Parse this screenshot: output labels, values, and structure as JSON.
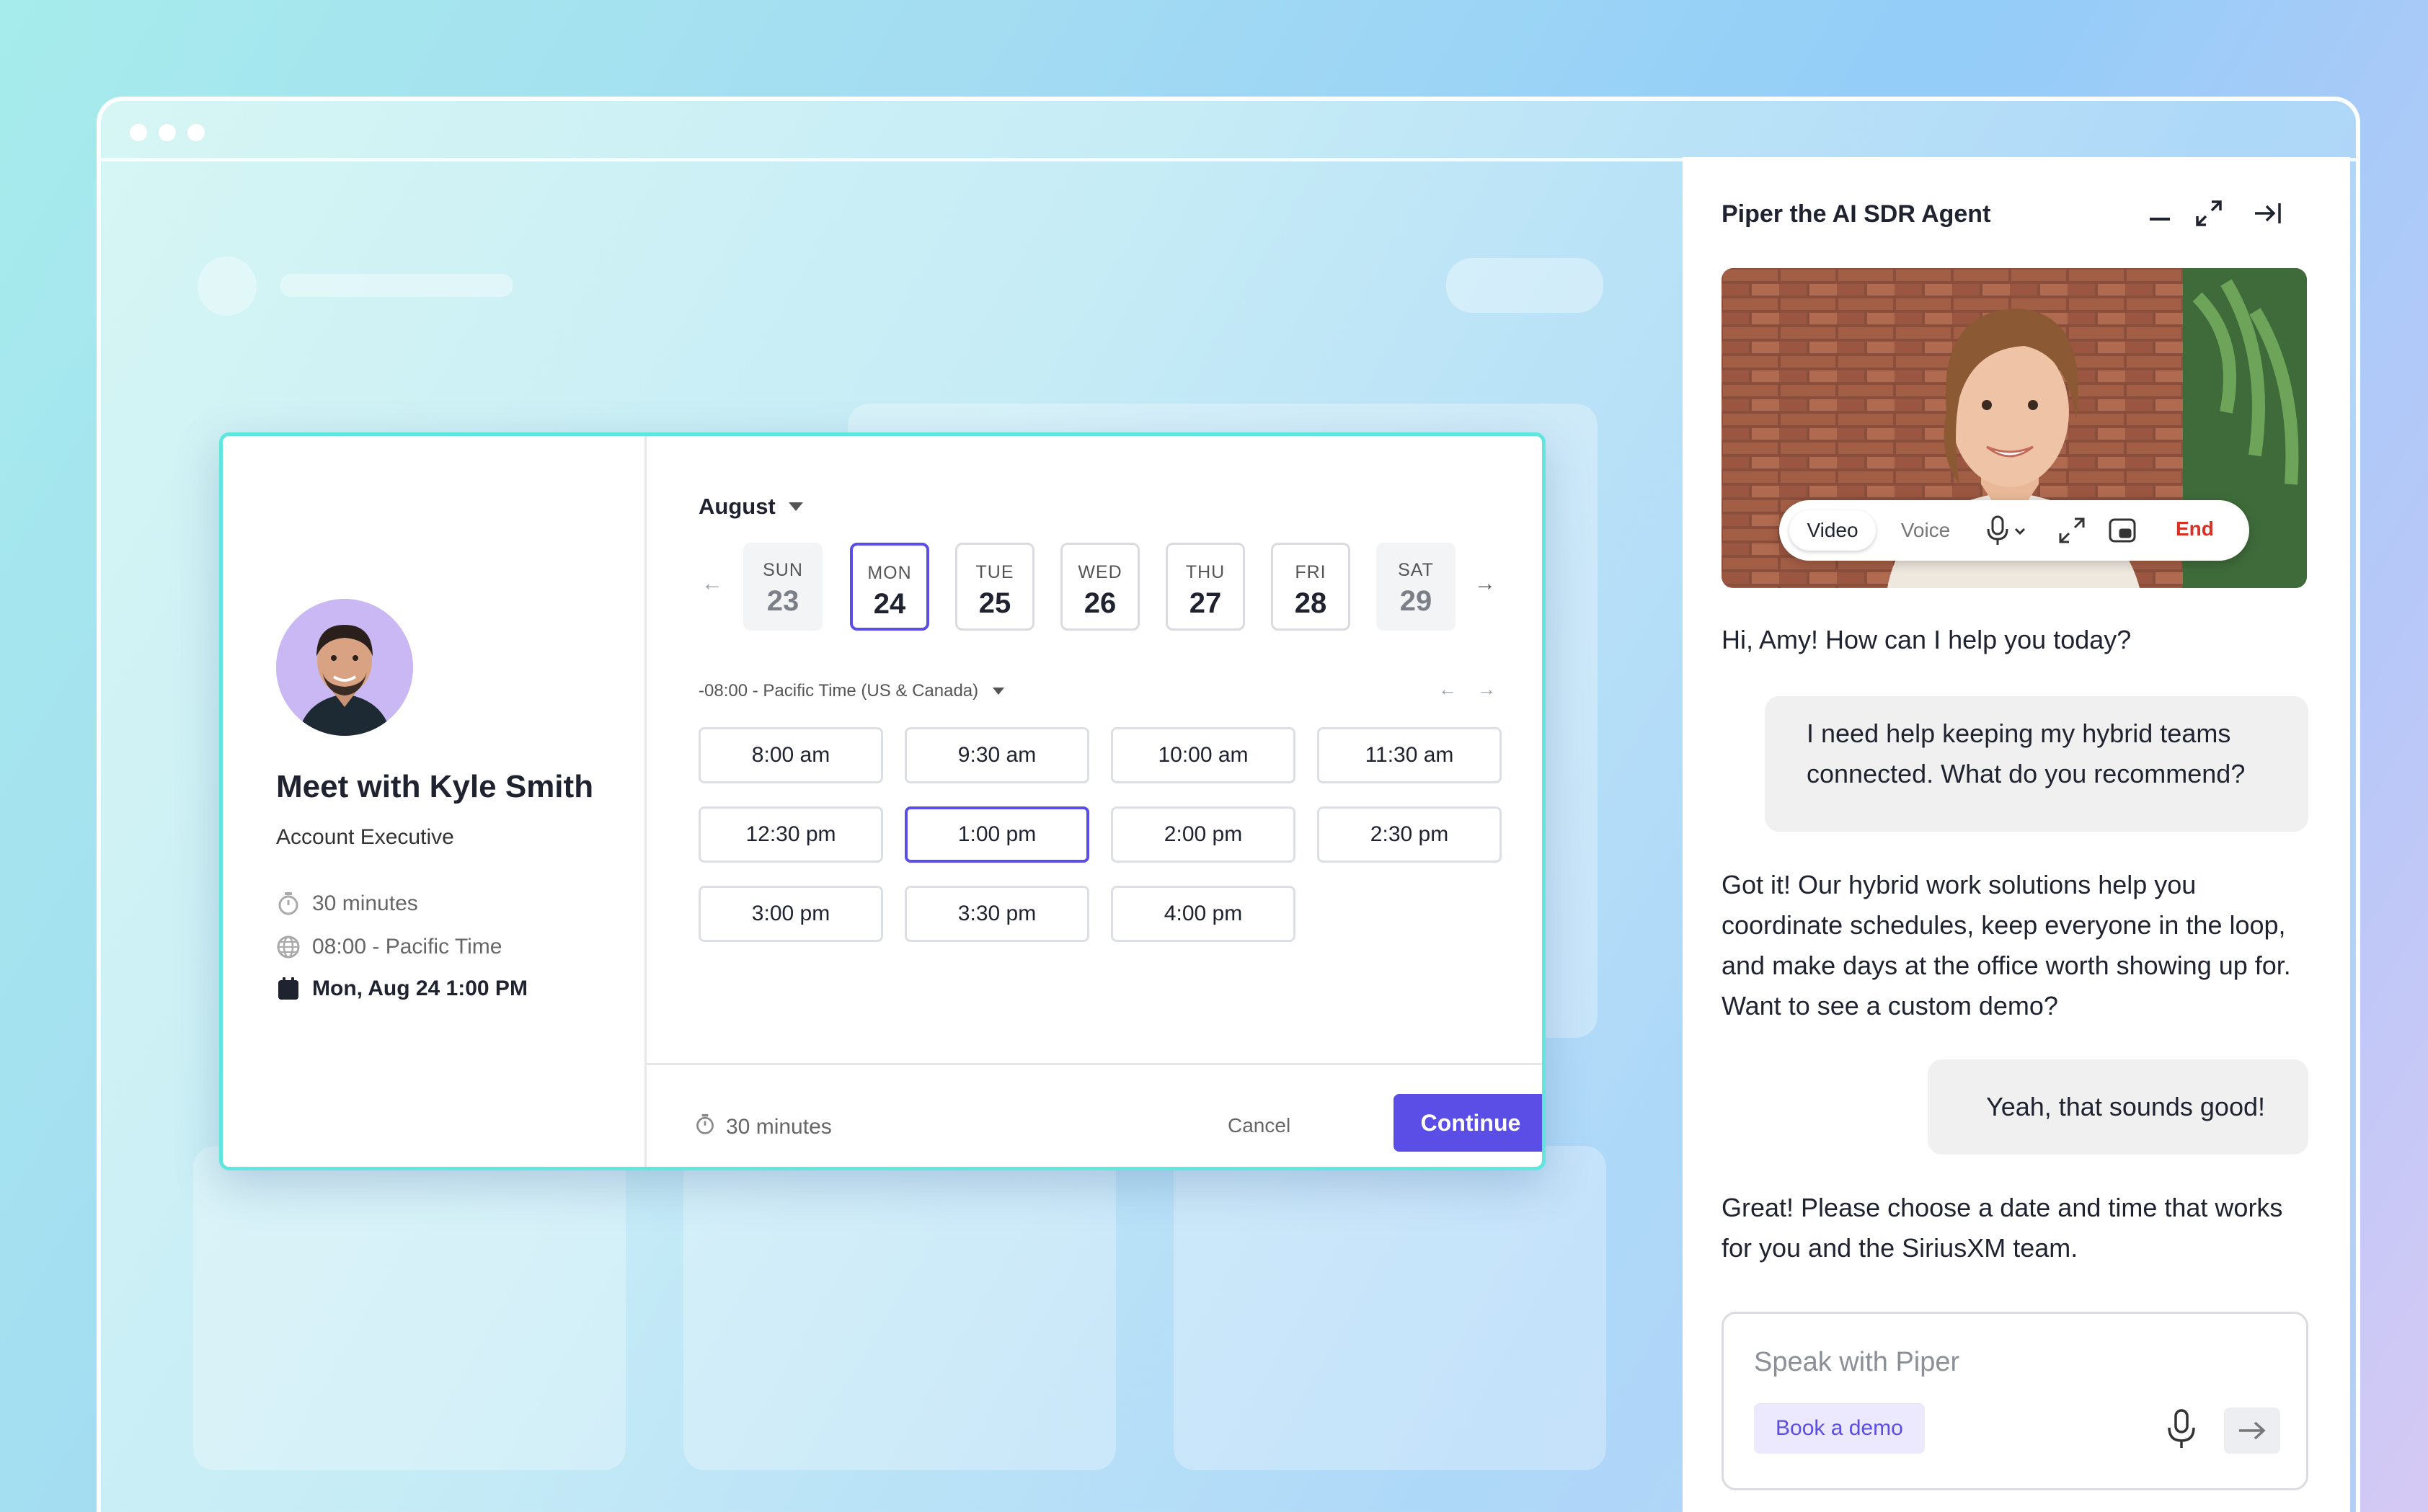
{
  "agent": {
    "title": "Piper the AI SDR Agent",
    "video_controls": {
      "video_label": "Video",
      "voice_label": "Voice",
      "end_label": "End"
    },
    "messages": [
      {
        "role": "agent",
        "text": "Hi, Amy! How can I help you today?"
      },
      {
        "role": "user",
        "text": "I need help keeping my hybrid teams connected. What do you recommend?"
      },
      {
        "role": "agent",
        "text": "Got it! Our hybrid work solutions help you coordinate schedules, keep everyone in the loop, and make days at the office worth showing up for. Want to see a custom demo?"
      },
      {
        "role": "user",
        "text": "Yeah, that sounds good!"
      },
      {
        "role": "agent",
        "text": "Great! Please choose a date and time that works for you and the SiriusXM team."
      }
    ],
    "composer": {
      "placeholder": "Speak with Piper",
      "chip_label": "Book a demo"
    }
  },
  "scheduler": {
    "host": {
      "name": "Meet with Kyle Smith",
      "title": "Account Executive"
    },
    "details": {
      "duration": "30 minutes",
      "timezone": "08:00 - Pacific Time",
      "selected_datetime": "Mon, Aug 24 1:00 PM"
    },
    "month": "August",
    "days": [
      {
        "name": "SUN",
        "date": "23"
      },
      {
        "name": "MON",
        "date": "24"
      },
      {
        "name": "TUE",
        "date": "25"
      },
      {
        "name": "WED",
        "date": "26"
      },
      {
        "name": "THU",
        "date": "27"
      },
      {
        "name": "FRI",
        "date": "28"
      },
      {
        "name": "SAT",
        "date": "29"
      }
    ],
    "selected_day": "24",
    "timezone_label": "-08:00 - Pacific Time (US & Canada)",
    "slots": [
      "8:00 am",
      "9:30 am",
      "10:00 am",
      "11:30 am",
      "12:30 pm",
      "1:00 pm",
      "2:00 pm",
      "2:30 pm",
      "3:00 pm",
      "3:30 pm",
      "4:00 pm"
    ],
    "selected_slot": "1:00 pm",
    "footer": {
      "duration": "30 minutes",
      "cancel_label": "Cancel",
      "continue_label": "Continue"
    }
  },
  "colors": {
    "accent": "#5b4ee6",
    "end": "#d93025",
    "card_border": "#5fe6df"
  }
}
